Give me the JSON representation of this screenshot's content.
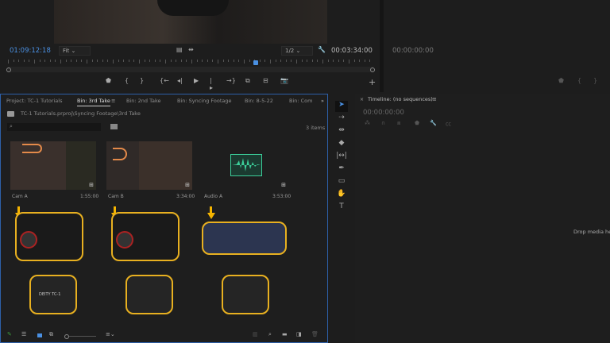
{
  "source_monitor": {
    "timecode": "01:09:12:18",
    "zoom": "Fit",
    "resolution": "1/2",
    "duration": "00:03:34:00"
  },
  "program_monitor": {
    "timecode": "00:00:00:00"
  },
  "project": {
    "tabs": [
      "Project: TC-1 Tutorials",
      "Bin: 3rd Take",
      "Bin: 2nd Take",
      "Bin: Syncing Footage",
      "Bin: 8-5-22",
      "Bin: Com"
    ],
    "active_tab": "Bin: 3rd Take",
    "path": "TC-1 Tutorials.prproj\\Syncing Footage\\3rd Take",
    "search_placeholder": "",
    "count": "3 items",
    "items": [
      {
        "name": "Cam A",
        "duration": "1:55:00"
      },
      {
        "name": "Cam B",
        "duration": "3:34:00"
      },
      {
        "name": "Audio A",
        "duration": "3:53:00"
      }
    ],
    "overlay_labels": {
      "tc1": "DEITY TC-1",
      "recorder": ""
    }
  },
  "timeline": {
    "title": "Timeline: (no sequences)",
    "timecode": "00:00:00:00",
    "empty_text": "Drop media here"
  },
  "colors": {
    "accent": "#4a90e2",
    "highlight": "#f5b400",
    "waveform": "#3ccf9a",
    "panel_border": "#2d5fa8"
  }
}
